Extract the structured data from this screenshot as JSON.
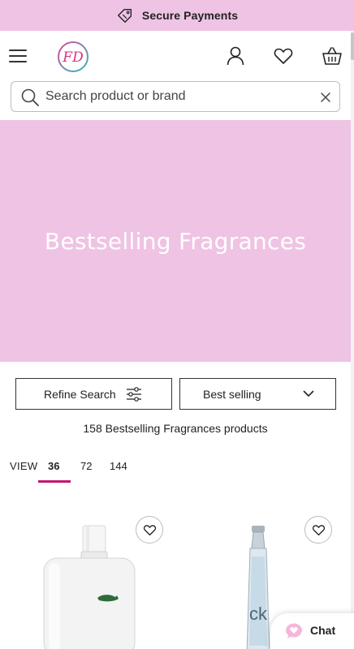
{
  "promo": {
    "text": "Secure Payments",
    "icon": "tag-icon"
  },
  "header": {
    "logo_text": "FD",
    "icons": [
      "menu-icon",
      "account-icon",
      "wishlist-heart-icon",
      "basket-icon"
    ]
  },
  "search": {
    "placeholder": "Search product or brand",
    "value": ""
  },
  "hero": {
    "title": "Bestselling Fragrances",
    "background": "#efc3e3"
  },
  "filters": {
    "refine_label": "Refine Search",
    "sort_selected": "Best selling"
  },
  "results": {
    "count_text": "158 Bestselling Fragrances products"
  },
  "view": {
    "label": "VIEW",
    "options": [
      "36",
      "72",
      "144"
    ],
    "selected": "36"
  },
  "products": [
    {
      "image": "lacoste-white-bottle",
      "brand_mark": "crocodile-logo"
    },
    {
      "image": "ck-in2u-bottle",
      "brand_mark": "ck"
    }
  ],
  "chat": {
    "label": "Chat"
  },
  "colors": {
    "accent": "#c2166f",
    "hero_pink": "#efc3e3",
    "logo_pink": "#e0469a",
    "logo_teal": "#2cbfb8"
  }
}
